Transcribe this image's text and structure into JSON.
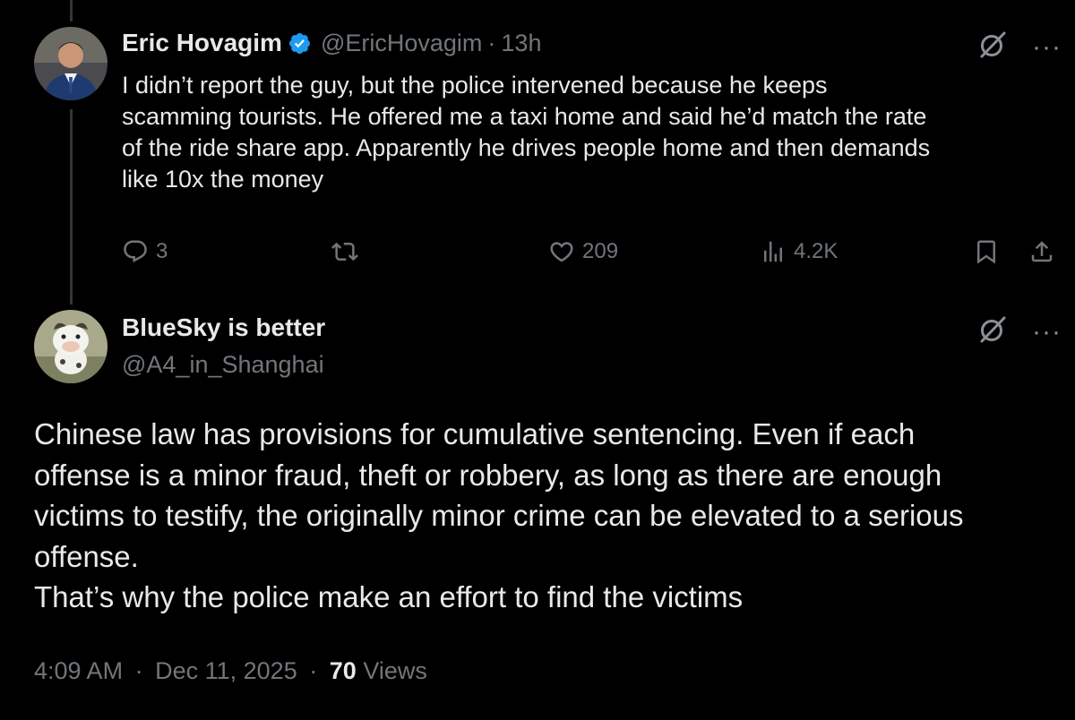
{
  "colors": {
    "background": "#000000",
    "text_primary": "#e7e9ea",
    "text_secondary": "#71767b",
    "verified_badge": "#1d9bf0",
    "thread_line": "#333639"
  },
  "parent_tweet": {
    "display_name": "Eric Hovagim",
    "verified": true,
    "handle": "@EricHovagim",
    "separator": "·",
    "time": "13h",
    "text": "I didn’t report the guy, but the police intervened because he keeps\nscamming tourists. He offered me a taxi home and said he’d match the rate\nof the ride share app. Apparently he drives people home and then demands\nlike 10x the money",
    "actions": {
      "replies": "3",
      "retweets": "",
      "likes": "209",
      "views": "4.2K"
    },
    "icons": [
      "grok-icon",
      "more-icon",
      "reply-icon",
      "retweet-icon",
      "like-icon",
      "views-icon",
      "bookmark-icon",
      "share-icon"
    ]
  },
  "reply_tweet": {
    "display_name": "BlueSky is better",
    "handle": "@A4_in_Shanghai",
    "text": "Chinese law has provisions for cumulative sentencing. Even if each\noffense is a minor fraud, theft or robbery, as long as there are enough\nvictims to testify, the originally minor crime can be elevated to a serious\noffense.\nThat’s why the police make an effort to find the victims",
    "time": "4:09 AM",
    "separator": "·",
    "date": "Dec 11, 2025",
    "views_count": "70",
    "views_label": "Views"
  }
}
